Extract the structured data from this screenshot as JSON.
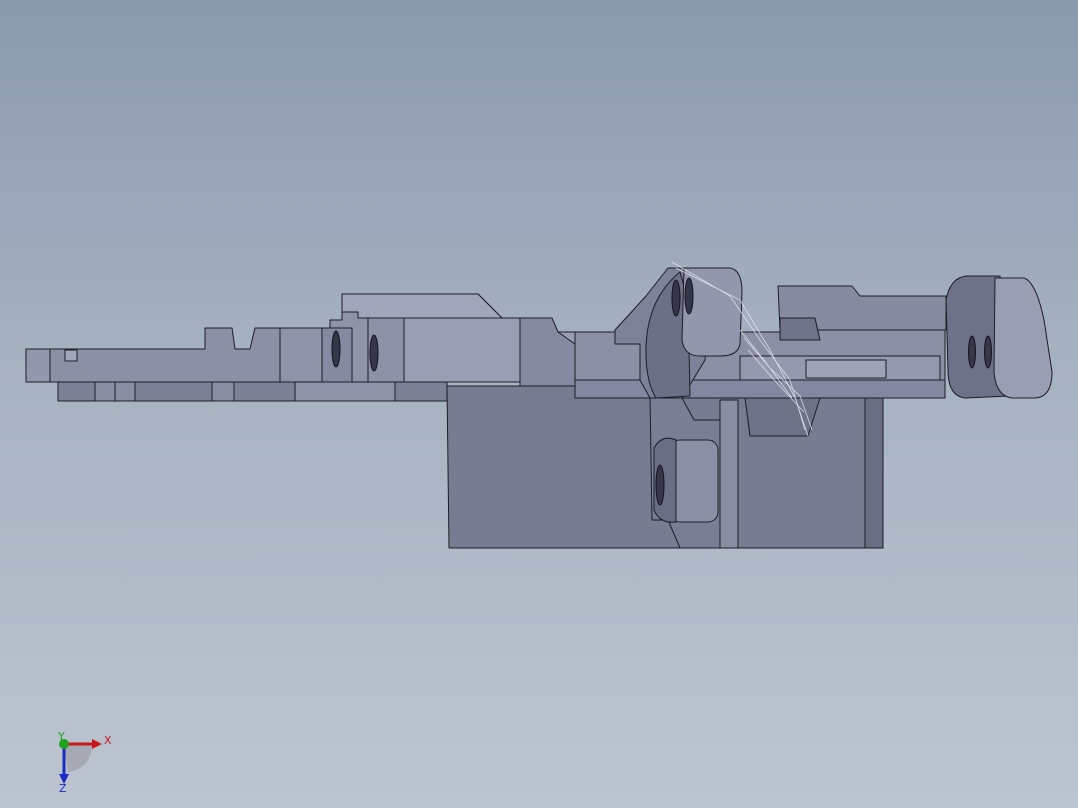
{
  "scene": {
    "background_top": "#8b9aae",
    "background_bottom": "#bcc4d0",
    "part_color": "#7c8196",
    "part_light": "#9599ad",
    "part_dark": "#5e6275",
    "edge_color": "#1c1d26"
  },
  "triad": {
    "x_label": "X",
    "y_label": "Y",
    "z_label": "Z",
    "x_color": "#c8181c",
    "y_color": "#1fa31f",
    "z_color": "#1c2bc4"
  }
}
